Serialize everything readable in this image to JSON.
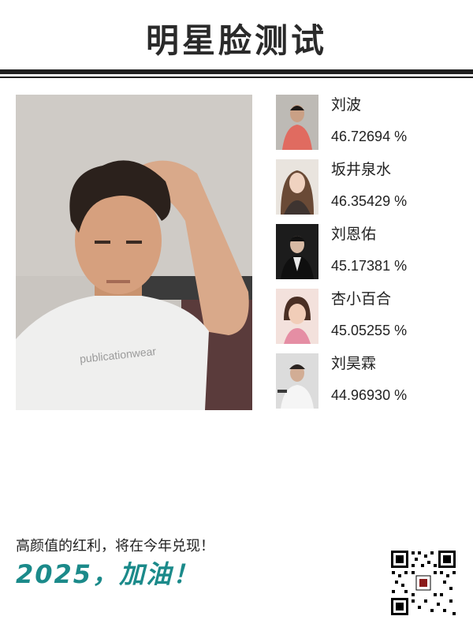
{
  "header": {
    "title": "明星脸测试"
  },
  "main_photo": {
    "shirt_text": "publicationwear"
  },
  "matches": [
    {
      "name": "刘波",
      "score": "46.72694 %"
    },
    {
      "name": "坂井泉水",
      "score": "46.35429 %"
    },
    {
      "name": "刘恩佑",
      "score": "45.17381 %"
    },
    {
      "name": "杏小百合",
      "score": "45.05255 %"
    },
    {
      "name": "刘昊霖",
      "score": "44.96930 %"
    }
  ],
  "footer": {
    "tagline": "高颜值的红利，将在今年兑现！",
    "slogan": "2025，加油！"
  },
  "colors": {
    "title": "#2a2a2a",
    "slogan": "#1b8a8a",
    "rule": "#1f1f1f"
  },
  "icons": {
    "qr_code": "qr-code-icon"
  }
}
